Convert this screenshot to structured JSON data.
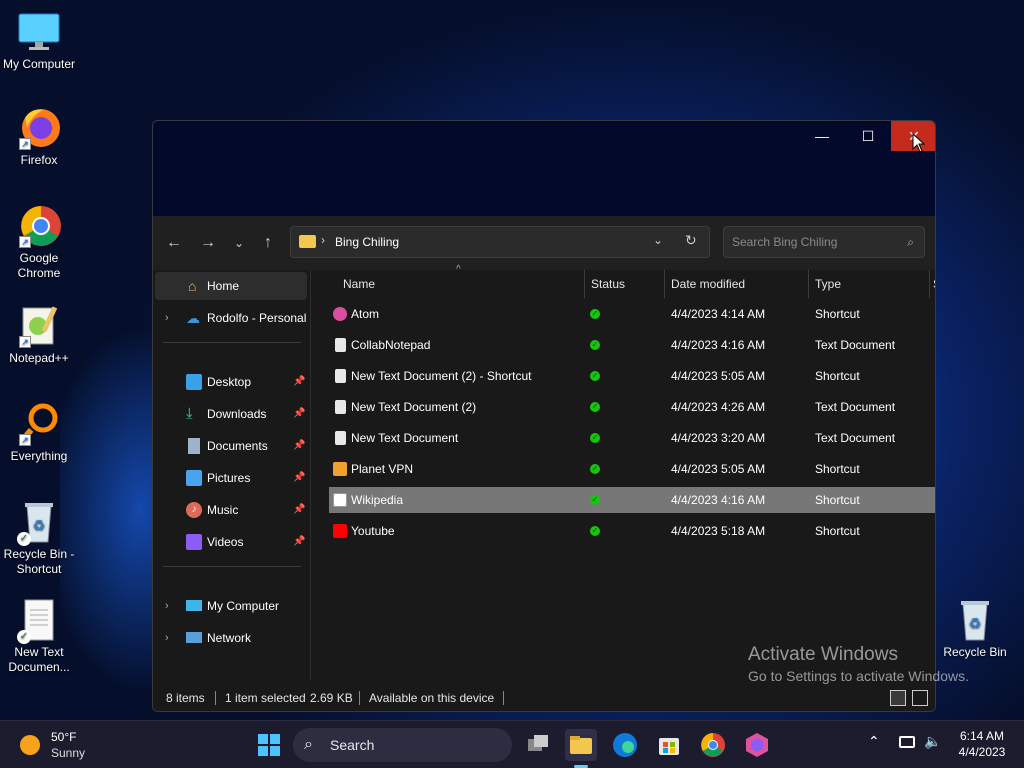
{
  "desktop": {
    "icons": [
      {
        "label": "My Computer"
      },
      {
        "label": "Firefox"
      },
      {
        "label": "Google Chrome"
      },
      {
        "label": "Notepad++"
      },
      {
        "label": "Everything"
      },
      {
        "label": "Recycle Bin - Shortcut"
      },
      {
        "label": "New Text Documen..."
      },
      {
        "label": "Recycle Bin"
      }
    ],
    "watermark_title": "Activate Windows",
    "watermark_sub": "Go to Settings to activate Windows."
  },
  "window": {
    "minimize_glyph": "—",
    "maximize_glyph": "☐",
    "close_glyph": "✕",
    "address_path": "Bing Chiling",
    "search_placeholder": "Search Bing Chiling"
  },
  "nav": {
    "home": "Home",
    "onedrive": "Rodolfo - Personal",
    "quick": [
      {
        "label": "Desktop"
      },
      {
        "label": "Downloads"
      },
      {
        "label": "Documents"
      },
      {
        "label": "Pictures"
      },
      {
        "label": "Music"
      },
      {
        "label": "Videos"
      }
    ],
    "my_computer": "My Computer",
    "network": "Network"
  },
  "columns": {
    "name": "Name",
    "status": "Status",
    "date": "Date modified",
    "type": "Type",
    "size": "S"
  },
  "files": [
    {
      "name": "Atom",
      "date": "4/4/2023 4:14 AM",
      "type": "Shortcut",
      "icon": "atom-icon",
      "color": "#d94fa0"
    },
    {
      "name": "CollabNotepad",
      "date": "4/4/2023 4:16 AM",
      "type": "Text Document",
      "icon": "text-file-icon",
      "color": "#e8e8e8"
    },
    {
      "name": "New Text Document (2) - Shortcut",
      "date": "4/4/2023 5:05 AM",
      "type": "Shortcut",
      "icon": "text-file-icon",
      "color": "#e8e8e8"
    },
    {
      "name": "New Text Document (2)",
      "date": "4/4/2023 4:26 AM",
      "type": "Text Document",
      "icon": "text-file-icon",
      "color": "#e8e8e8"
    },
    {
      "name": "New Text Document",
      "date": "4/4/2023 3:20 AM",
      "type": "Text Document",
      "icon": "text-file-icon",
      "color": "#e8e8e8"
    },
    {
      "name": "Planet VPN",
      "date": "4/4/2023 5:05 AM",
      "type": "Shortcut",
      "icon": "planet-vpn-icon",
      "color": "#f0a030"
    },
    {
      "name": "Wikipedia",
      "date": "4/4/2023 4:16 AM",
      "type": "Shortcut",
      "icon": "wikipedia-icon",
      "color": "#ffffff"
    },
    {
      "name": "Youtube",
      "date": "4/4/2023 5:18 AM",
      "type": "Shortcut",
      "icon": "youtube-icon",
      "color": "#ff0000"
    }
  ],
  "statusbar": {
    "items": "8 items",
    "selected": "1 item selected",
    "size": "2.69 KB",
    "availability": "Available on this device"
  },
  "taskbar": {
    "weather_temp": "50°F",
    "weather_cond": "Sunny",
    "search_label": "Search",
    "time": "6:14 AM",
    "date": "4/4/2023"
  }
}
